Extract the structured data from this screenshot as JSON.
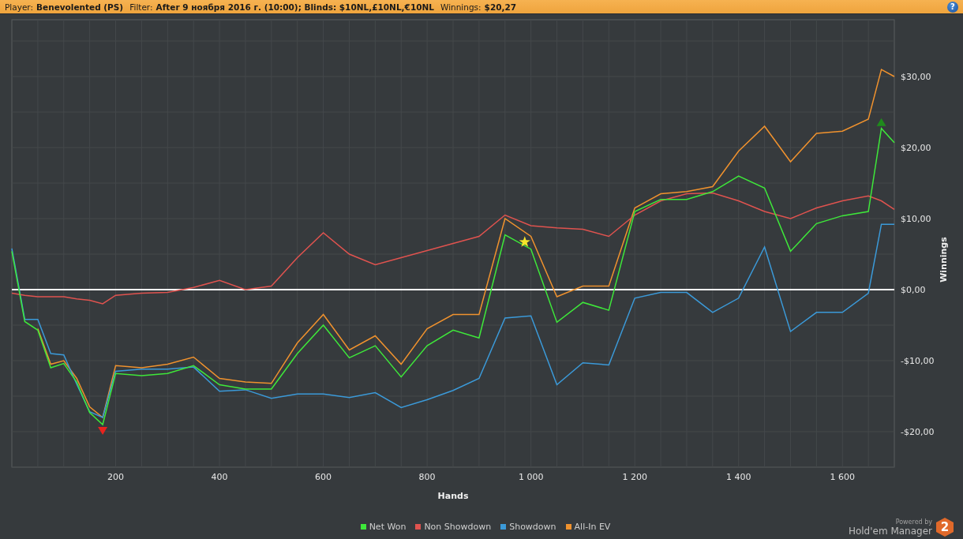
{
  "header": {
    "fields": [
      {
        "label": "Player:",
        "value": "Benevolented (PS)"
      },
      {
        "label": "Filter:",
        "value": "After 9 ноября 2016 г. (10:00); Blinds: $10NL,£10NL,€10NL"
      },
      {
        "label": "Winnings:",
        "value": "$20,27"
      }
    ],
    "help_button": "?"
  },
  "chart": {
    "chart_data": {
      "type": "line",
      "xlabel": "Hands",
      "ylabel": "Winnings",
      "xlim": [
        0,
        1700
      ],
      "ylim": [
        -25,
        38
      ],
      "grid": true,
      "xticks": [
        200,
        400,
        600,
        800,
        {
          "value": 1000,
          "label": "1 000"
        },
        {
          "value": 1200,
          "label": "1 200"
        },
        {
          "value": 1400,
          "label": "1 400"
        },
        {
          "value": 1600,
          "label": "1 600"
        }
      ],
      "yticks": [
        {
          "value": -20,
          "label": "-$20,00"
        },
        {
          "value": -10,
          "label": "-$10,00"
        },
        {
          "value": 0,
          "label": "$0,00"
        },
        {
          "value": 10,
          "label": "$10,00"
        },
        {
          "value": 20,
          "label": "$20,00"
        },
        {
          "value": 30,
          "label": "$30,00"
        }
      ],
      "x": [
        0,
        25,
        50,
        75,
        100,
        125,
        150,
        175,
        200,
        250,
        300,
        350,
        400,
        450,
        500,
        550,
        600,
        650,
        700,
        750,
        800,
        850,
        900,
        950,
        1000,
        1050,
        1100,
        1150,
        1200,
        1250,
        1300,
        1350,
        1400,
        1450,
        1500,
        1550,
        1600,
        1650,
        1675,
        1700
      ],
      "series": [
        {
          "name": "Net Won",
          "color": "#3ee83a",
          "values": [
            5.4,
            -4.5,
            -5.7,
            -11,
            -10.4,
            -13,
            -17.3,
            -19,
            -11.8,
            -12.1,
            -11.8,
            -10.7,
            -13.4,
            -14,
            -14,
            -9,
            -5,
            -9.6,
            -7.9,
            -12.3,
            -7.9,
            -5.7,
            -6.8,
            7.7,
            5.7,
            -4.6,
            -1.8,
            -2.9,
            11,
            12.7,
            12.7,
            13.8,
            16,
            14.3,
            5.4,
            9.3,
            10.4,
            11,
            22.7,
            20.7
          ]
        },
        {
          "name": "Non Showdown",
          "color": "#e0534f",
          "values": [
            -0.5,
            -0.8,
            -1,
            -1,
            -1,
            -1.3,
            -1.5,
            -2,
            -0.8,
            -0.5,
            -0.4,
            0.3,
            1.3,
            0,
            0.5,
            4.5,
            8,
            5,
            3.5,
            4.5,
            5.5,
            6.5,
            7.5,
            10.5,
            9,
            8.7,
            8.5,
            7.5,
            10.5,
            12.5,
            13.5,
            13.6,
            12.5,
            11,
            10,
            11.5,
            12.5,
            13.2,
            12.5,
            11.3
          ]
        },
        {
          "name": "Showdown",
          "color": "#3b9ad9",
          "values": [
            5.8,
            -4.2,
            -4.2,
            -9,
            -9.2,
            -13.3,
            -17.2,
            -18,
            -11.5,
            -11.2,
            -11.2,
            -10.9,
            -14.3,
            -14.1,
            -15.3,
            -14.7,
            -14.7,
            -15.2,
            -14.5,
            -16.6,
            -15.5,
            -14.2,
            -12.5,
            -4,
            -3.7,
            -13.4,
            -10.3,
            -10.6,
            -1.2,
            -0.4,
            -0.4,
            -3.2,
            -1.2,
            6,
            -5.9,
            -3.2,
            -3.2,
            -0.5,
            9.2,
            9.2
          ]
        },
        {
          "name": "All-In EV",
          "color": "#f0922e",
          "values": [
            null,
            null,
            -5.5,
            -10.5,
            -10,
            -12.5,
            -16.5,
            -18,
            -10.7,
            -11,
            -10.5,
            -9.5,
            -12.5,
            -13,
            -13.2,
            -7.5,
            -3.5,
            -8.5,
            -6.5,
            -10.5,
            -5.5,
            -3.5,
            -3.5,
            10,
            7.5,
            -1,
            0.5,
            0.5,
            11.5,
            13.5,
            13.8,
            14.5,
            19.5,
            23,
            18,
            22,
            22.3,
            24,
            31,
            30
          ]
        }
      ]
    },
    "markers": [
      {
        "kind": "low"
      },
      {
        "kind": "star"
      },
      {
        "kind": "high"
      }
    ]
  },
  "branding": {
    "powered_by": "Powered by",
    "product": "Hold'em Manager",
    "badge": "2"
  }
}
